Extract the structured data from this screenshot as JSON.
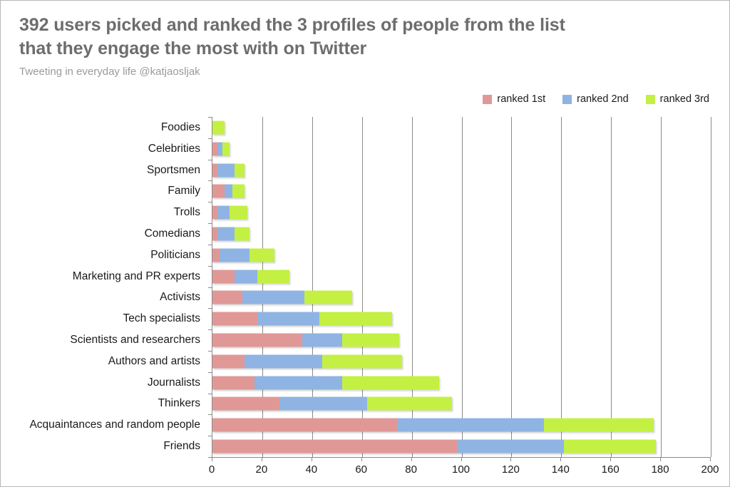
{
  "header": {
    "title": "392 users picked and ranked the 3 profiles of people from the list\nthat they engage the most with on Twitter",
    "subtitle": "Tweeting in everyday life @katjaosljak"
  },
  "legend": {
    "items": [
      {
        "label": "ranked 1st",
        "color": "#e09896"
      },
      {
        "label": "ranked 2nd",
        "color": "#8fb4e3"
      },
      {
        "label": "ranked 3rd",
        "color": "#c3f043"
      }
    ]
  },
  "axis": {
    "x_ticks": [
      "0",
      "20",
      "40",
      "60",
      "80",
      "100",
      "120",
      "140",
      "160",
      "180",
      "200"
    ]
  },
  "chart_data": {
    "type": "bar",
    "orientation": "horizontal",
    "stacked": true,
    "title": "392 users picked and ranked the 3 profiles of people from the list that they engage the most with on Twitter",
    "subtitle": "Tweeting in everyday life @katjaosljak",
    "xlabel": "",
    "ylabel": "",
    "xlim": [
      0,
      200
    ],
    "grid": true,
    "legend_position": "top-right",
    "categories": [
      "Foodies",
      "Celebrities",
      "Sportsmen",
      "Family",
      "Trolls",
      "Comedians",
      "Politicians",
      "Marketing and PR experts",
      "Activists",
      "Tech specialists",
      "Scientists and researchers",
      "Authors and artists",
      "Journalists",
      "Thinkers",
      "Acquaintances and random people",
      "Friends"
    ],
    "series": [
      {
        "name": "ranked 1st",
        "color": "#e09896",
        "values": [
          0,
          2,
          2,
          5,
          2,
          2,
          3,
          9,
          12,
          18,
          36,
          13,
          17,
          27,
          74,
          98
        ]
      },
      {
        "name": "ranked 2nd",
        "color": "#8fb4e3",
        "values": [
          0,
          2,
          7,
          3,
          5,
          7,
          12,
          9,
          25,
          25,
          16,
          31,
          35,
          35,
          59,
          43
        ]
      },
      {
        "name": "ranked 3rd",
        "color": "#c3f043",
        "values": [
          5,
          3,
          4,
          5,
          7,
          6,
          10,
          13,
          19,
          29,
          23,
          32,
          39,
          34,
          44,
          37
        ]
      }
    ],
    "totals": [
      5,
      7,
      13,
      13,
      14,
      15,
      25,
      31,
      56,
      72,
      75,
      76,
      91,
      96,
      177,
      178
    ]
  }
}
